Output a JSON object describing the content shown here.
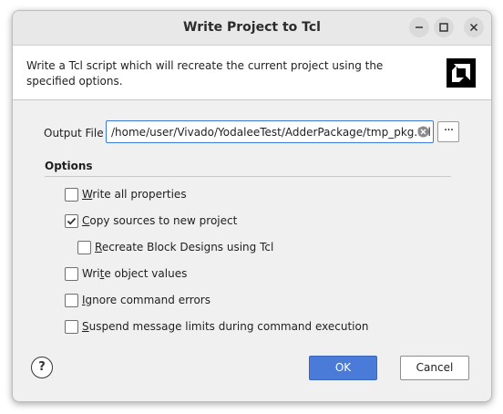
{
  "window": {
    "title": "Write Project to Tcl",
    "controls": [
      "minimize-icon",
      "maximize-icon",
      "close-icon"
    ]
  },
  "header": {
    "description": "Write a Tcl script which will recreate the current project using the specified options.",
    "logo_icon": "amd-logo-icon"
  },
  "output_file": {
    "label": "Output File",
    "value": "/home/user/Vivado/YodaleeTest/AdderPackage/tmp_pkg.tcl",
    "clear_icon": "clear-icon",
    "browse_label": "···"
  },
  "options": {
    "heading": "Options",
    "items": [
      {
        "mnemonic": "W",
        "rest": "rite all properties",
        "checked": false
      },
      {
        "mnemonic": "C",
        "rest": "opy sources to new project",
        "checked": true
      },
      {
        "mnemonic": "R",
        "rest": "ecreate Block Designs using Tcl",
        "checked": false
      },
      {
        "pre": "Wri",
        "mnemonic": "t",
        "rest": "e object values",
        "checked": false
      },
      {
        "mnemonic": "I",
        "rest": "gnore command errors",
        "checked": false
      },
      {
        "mnemonic": "S",
        "rest": "uspend message limits during command execution",
        "checked": false
      }
    ]
  },
  "buttons": {
    "help": "?",
    "ok": "OK",
    "cancel": "Cancel"
  },
  "colors": {
    "accent": "#4a7bd8",
    "focus_border": "#3a7bd5",
    "dialog_bg": "#f0f0f0"
  }
}
